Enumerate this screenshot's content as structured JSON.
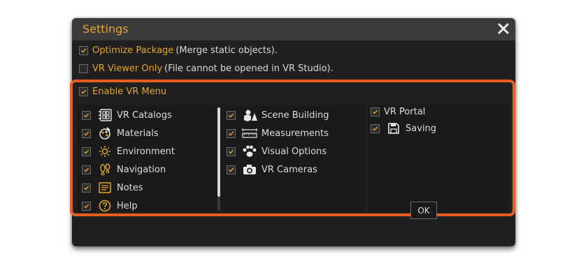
{
  "dialog": {
    "title": "Settings"
  },
  "options": {
    "optimize": {
      "label": "Optimize Package",
      "note": "(Merge static objects).",
      "checked": true
    },
    "viewer_only": {
      "label": "VR Viewer Only",
      "note": "(File cannot be opened in VR Studio).",
      "checked": false
    },
    "enable_vr_menu": {
      "label": "Enable VR Menu",
      "checked": true
    }
  },
  "menu_items": {
    "col1": [
      {
        "label": "VR Catalogs",
        "icon": "catalog-icon",
        "checked": true
      },
      {
        "label": "Materials",
        "icon": "materials-icon",
        "checked": true
      },
      {
        "label": "Environment",
        "icon": "sun-icon",
        "checked": true
      },
      {
        "label": "Navigation",
        "icon": "footprints-icon",
        "checked": true
      },
      {
        "label": "Notes",
        "icon": "notes-icon",
        "checked": true
      },
      {
        "label": "Help",
        "icon": "help-icon",
        "checked": true
      }
    ],
    "col2": [
      {
        "label": "Scene Building",
        "icon": "shapes-icon",
        "checked": true
      },
      {
        "label": "Measurements",
        "icon": "ruler-icon",
        "checked": true
      },
      {
        "label": "Visual Options",
        "icon": "paw-icon",
        "checked": true
      },
      {
        "label": "VR Cameras",
        "icon": "camera-icon",
        "checked": true
      }
    ],
    "col3": [
      {
        "label": "VR Portal",
        "icon": "",
        "checked": true
      },
      {
        "label": "Saving",
        "icon": "save-icon",
        "checked": true
      }
    ]
  },
  "buttons": {
    "ok": "OK"
  },
  "colors": {
    "accent": "#e3a531",
    "highlight": "#ec5b22",
    "panel": "#202020",
    "titlebar": "#3b3b3b"
  }
}
